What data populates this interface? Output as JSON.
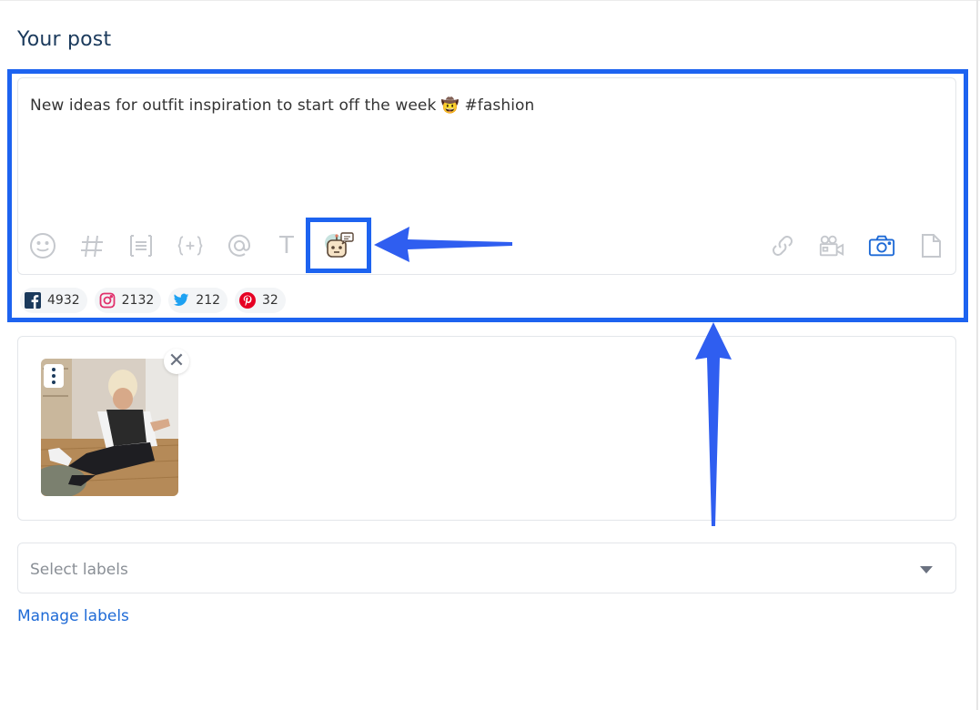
{
  "section_title": "Your post",
  "post": {
    "text": "New ideas for outfit inspiration to start off the week",
    "emoji": "🤠",
    "hashtag": "#fashion"
  },
  "toolbar": {
    "left_tools": [
      "emoji-icon",
      "hashtag-icon",
      "text-block-icon",
      "variable-icon",
      "mention-icon",
      "text-format-icon",
      "ai-assistant-bot-icon"
    ],
    "right_tools": [
      "link-icon",
      "video-icon",
      "camera-icon",
      "document-icon"
    ],
    "text_tool_glyph": "T"
  },
  "stats": [
    {
      "network": "facebook",
      "icon": "facebook-icon",
      "count": "4932",
      "color": "#1b3a5c"
    },
    {
      "network": "instagram",
      "icon": "instagram-icon",
      "count": "2132",
      "color": "#e1306c"
    },
    {
      "network": "twitter",
      "icon": "twitter-icon",
      "count": "212",
      "color": "#1da1f2"
    },
    {
      "network": "pinterest",
      "icon": "pinterest-icon",
      "count": "32",
      "color": "#e60023"
    }
  ],
  "labels": {
    "placeholder": "Select labels",
    "manage_link": "Manage labels"
  },
  "colors": {
    "highlight": "#1d63f0",
    "title": "#1b3a5c",
    "link": "#1e6ad6",
    "tool_gray": "#c5c8cd",
    "camera_blue": "#1e6ad6"
  }
}
